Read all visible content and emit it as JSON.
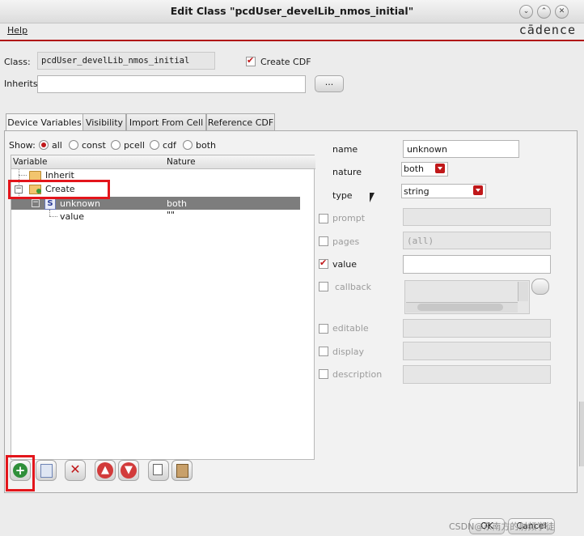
{
  "window": {
    "title": "Edit Class \"pcdUser_develLib_nmos_initial\""
  },
  "menu": {
    "help": "Help"
  },
  "brand": {
    "logo": "cādence"
  },
  "header": {
    "class_label": "Class:",
    "class_value": "pcdUser_develLib_nmos_initial",
    "create_cdf_label": "Create CDF",
    "create_cdf_checked": true,
    "inherits_label": "Inherits",
    "inherits_value": "",
    "browse_label": "..."
  },
  "tabs": [
    {
      "label": "Device Variables",
      "active": true
    },
    {
      "label": "Visibility",
      "active": false
    },
    {
      "label": "Import From Cell",
      "active": false
    },
    {
      "label": "Reference CDF",
      "active": false
    }
  ],
  "show": {
    "label": "Show:",
    "options": [
      "all",
      "const",
      "pcell",
      "cdf",
      "both"
    ],
    "selected": "all"
  },
  "tree": {
    "col_variable": "Variable",
    "col_nature": "Nature",
    "rows": [
      {
        "name": "Inherit",
        "nature": ""
      },
      {
        "name": "Create",
        "nature": ""
      },
      {
        "name": "unknown",
        "nature": "both",
        "badge": "S"
      },
      {
        "name": "value",
        "nature": "\"\""
      }
    ]
  },
  "form": {
    "name_label": "name",
    "name_value": "unknown",
    "nature_label": "nature",
    "nature_value": "both",
    "type_label": "type",
    "type_value": "string",
    "prompt_label": "prompt",
    "pages_label": "pages",
    "pages_value": "(all)",
    "value_label": "value",
    "callback_label": "callback",
    "editable_label": "editable",
    "display_label": "display",
    "description_label": "description"
  },
  "toolbar": {
    "icons": [
      "add-icon",
      "edit-icon",
      "delete-icon",
      "move-up-icon",
      "move-down-icon",
      "copy-icon",
      "paste-icon"
    ]
  },
  "footer": {
    "watermark": "CSDN@东南方的射频学徒",
    "btn1": "OK",
    "btn2": "Cancel"
  },
  "colors": {
    "accent": "#c0181a",
    "highlight_box": "#e3151b",
    "selected_row": "#7d7d7d"
  }
}
